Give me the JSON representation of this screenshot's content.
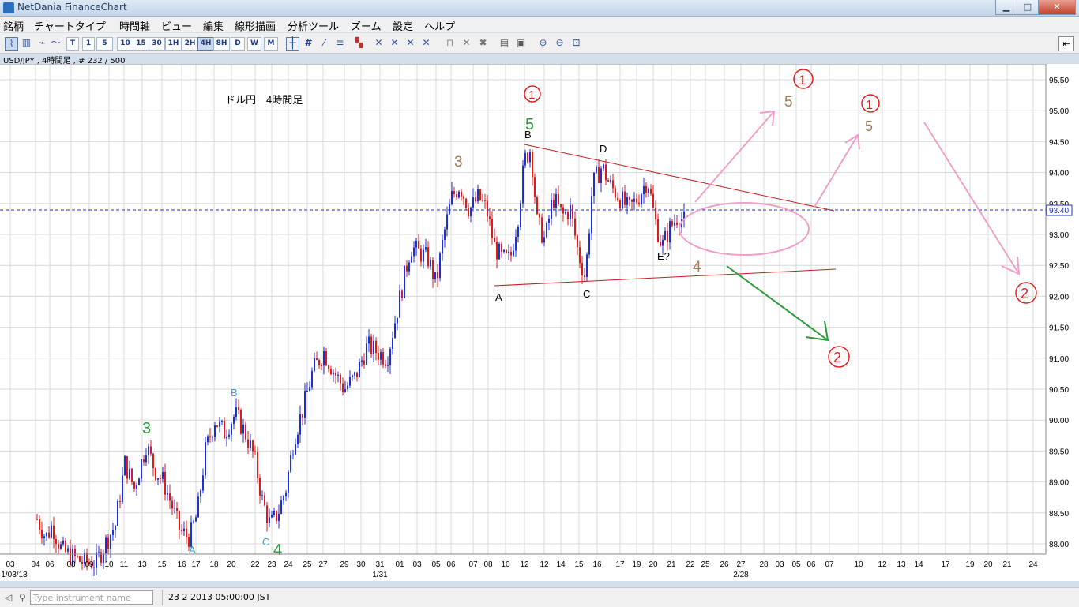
{
  "window": {
    "title": "NetDania FinanceChart",
    "minimize": "▁",
    "maximize": "□",
    "close": "✕"
  },
  "menu": [
    "銘柄",
    "チャートタイプ",
    "時間軸",
    "ビュー",
    "編集",
    "線形描画",
    "分析ツール",
    "ズーム",
    "設定",
    "ヘルプ"
  ],
  "toolbar": {
    "timeframes": [
      "T",
      "1",
      "5",
      "10",
      "15",
      "30",
      "1H",
      "2H",
      "4H",
      "8H",
      "D",
      "W",
      "M"
    ],
    "active_timeframe": "4H",
    "icons": [
      "chart-line-icon",
      "chart-bar-icon",
      "chart-area-icon",
      "crosshair-icon",
      "grid-icon",
      "indicator-icon",
      "zoom-in-icon",
      "zoom-out-icon",
      "print-icon",
      "delete-icon"
    ],
    "pin": "⇤"
  },
  "info_label": "USD/JPY , 4時間足 , # 232 / 500",
  "chart_data": {
    "type": "candlestick",
    "instrument": "USD/JPY",
    "timeframe": "4時間足",
    "title": "ドル円　4時間足",
    "ylim": [
      87.8,
      95.75
    ],
    "y_ticks": [
      "95.50",
      "95.00",
      "94.50",
      "94.00",
      "93.50",
      "93.00",
      "92.50",
      "92.00",
      "91.50",
      "91.00",
      "90.50",
      "90.00",
      "89.50",
      "89.00",
      "88.50",
      "88.00"
    ],
    "current_price": "93.40",
    "x_labels": [
      "03",
      "04",
      "06",
      "08",
      "09",
      "10",
      "11",
      "13",
      "15",
      "16",
      "17",
      "18",
      "20",
      "22",
      "23",
      "24",
      "25",
      "27",
      "29",
      "30",
      "31",
      "01",
      "03",
      "05",
      "06",
      "07",
      "08",
      "10",
      "12",
      "12",
      "14",
      "15",
      "16",
      "17",
      "19",
      "20",
      "21",
      "22",
      "25",
      "26",
      "27",
      "28",
      "03",
      "05",
      "06",
      "07",
      "10",
      "12",
      "13",
      "14",
      "17",
      "19",
      "20",
      "21",
      "24"
    ],
    "x_month_labels": [
      "1/03/13",
      "1/31",
      "2/28"
    ],
    "price_path": [
      [
        47,
        88.4
      ],
      [
        58,
        88.1
      ],
      [
        66,
        88.3
      ],
      [
        78,
        87.9
      ],
      [
        90,
        87.8
      ],
      [
        105,
        87.7
      ],
      [
        122,
        87.7
      ],
      [
        133,
        88.0
      ],
      [
        146,
        88.3
      ],
      [
        158,
        89.3
      ],
      [
        170,
        88.9
      ],
      [
        185,
        89.6
      ],
      [
        196,
        89.2
      ],
      [
        207,
        89.0
      ],
      [
        218,
        88.6
      ],
      [
        228,
        88.2
      ],
      [
        240,
        88.1
      ],
      [
        250,
        88.5
      ],
      [
        260,
        89.5
      ],
      [
        272,
        90.0
      ],
      [
        284,
        89.8
      ],
      [
        298,
        90.1
      ],
      [
        310,
        89.8
      ],
      [
        322,
        89.4
      ],
      [
        332,
        88.7
      ],
      [
        342,
        88.3
      ],
      [
        352,
        88.5
      ],
      [
        362,
        88.9
      ],
      [
        372,
        89.7
      ],
      [
        384,
        90.2
      ],
      [
        396,
        90.8
      ],
      [
        410,
        91.1
      ],
      [
        422,
        90.8
      ],
      [
        436,
        90.5
      ],
      [
        450,
        90.7
      ],
      [
        465,
        91.2
      ],
      [
        478,
        91.1
      ],
      [
        490,
        91.0
      ],
      [
        500,
        91.6
      ],
      [
        510,
        92.2
      ],
      [
        520,
        92.8
      ],
      [
        532,
        92.7
      ],
      [
        542,
        92.6
      ],
      [
        552,
        92.2
      ],
      [
        562,
        93.0
      ],
      [
        572,
        93.6
      ],
      [
        582,
        93.8
      ],
      [
        594,
        93.4
      ],
      [
        606,
        93.6
      ],
      [
        616,
        93.4
      ],
      [
        626,
        92.8
      ],
      [
        636,
        92.6
      ],
      [
        646,
        92.6
      ],
      [
        656,
        93.3
      ],
      [
        664,
        94.2
      ],
      [
        672,
        94.4
      ],
      [
        680,
        93.2
      ],
      [
        690,
        92.9
      ],
      [
        700,
        93.6
      ],
      [
        712,
        93.3
      ],
      [
        722,
        93.4
      ],
      [
        732,
        92.7
      ],
      [
        741,
        92.3
      ],
      [
        750,
        93.8
      ],
      [
        762,
        94.1
      ],
      [
        772,
        93.8
      ],
      [
        784,
        93.6
      ],
      [
        796,
        93.4
      ],
      [
        808,
        93.6
      ],
      [
        820,
        93.9
      ],
      [
        828,
        93.3
      ],
      [
        838,
        92.8
      ],
      [
        848,
        93.1
      ],
      [
        858,
        93.3
      ],
      [
        868,
        93.2
      ]
    ],
    "annotations": [
      {
        "text": "ドル円　4時間足",
        "color": "#000000",
        "note": "title"
      },
      {
        "text": "1",
        "color": "#e02020",
        "circled": true
      },
      {
        "text": "1",
        "color": "#e02020",
        "circled": true
      },
      {
        "text": "1",
        "color": "#e02020",
        "circled": true
      },
      {
        "text": "2",
        "color": "#e02020",
        "circled": true
      },
      {
        "text": "2",
        "color": "#e02020",
        "circled": true
      },
      {
        "text": "5",
        "color": "#2a9a3a"
      },
      {
        "text": "3",
        "color": "#2a9a3a"
      },
      {
        "text": "4",
        "color": "#2a9a3a"
      },
      {
        "text": "3",
        "color": "#a67c52"
      },
      {
        "text": "4",
        "color": "#a67c52"
      },
      {
        "text": "5",
        "color": "#a67c52"
      },
      {
        "text": "5",
        "color": "#a67c52"
      },
      {
        "text": "A",
        "color": "#000000"
      },
      {
        "text": "B",
        "color": "#000000"
      },
      {
        "text": "C",
        "color": "#000000"
      },
      {
        "text": "D",
        "color": "#000000"
      },
      {
        "text": "E?",
        "color": "#000000"
      },
      {
        "text": "A",
        "color": "#3aa0d0"
      },
      {
        "text": "B",
        "color": "#3aa0d0"
      },
      {
        "text": "C",
        "color": "#3aa0d0"
      }
    ],
    "colors": {
      "up": "#1f2fd6",
      "down": "#e01a1a",
      "grid": "#d8d8d8",
      "current": "#2030d0",
      "trendline": "#c02020",
      "pink": "#f0a0c8",
      "green_arrow": "#2a9a3a"
    }
  },
  "status": {
    "placeholder": "Type instrument name",
    "datetime": "23 2 2013 05:00:00 JST"
  }
}
